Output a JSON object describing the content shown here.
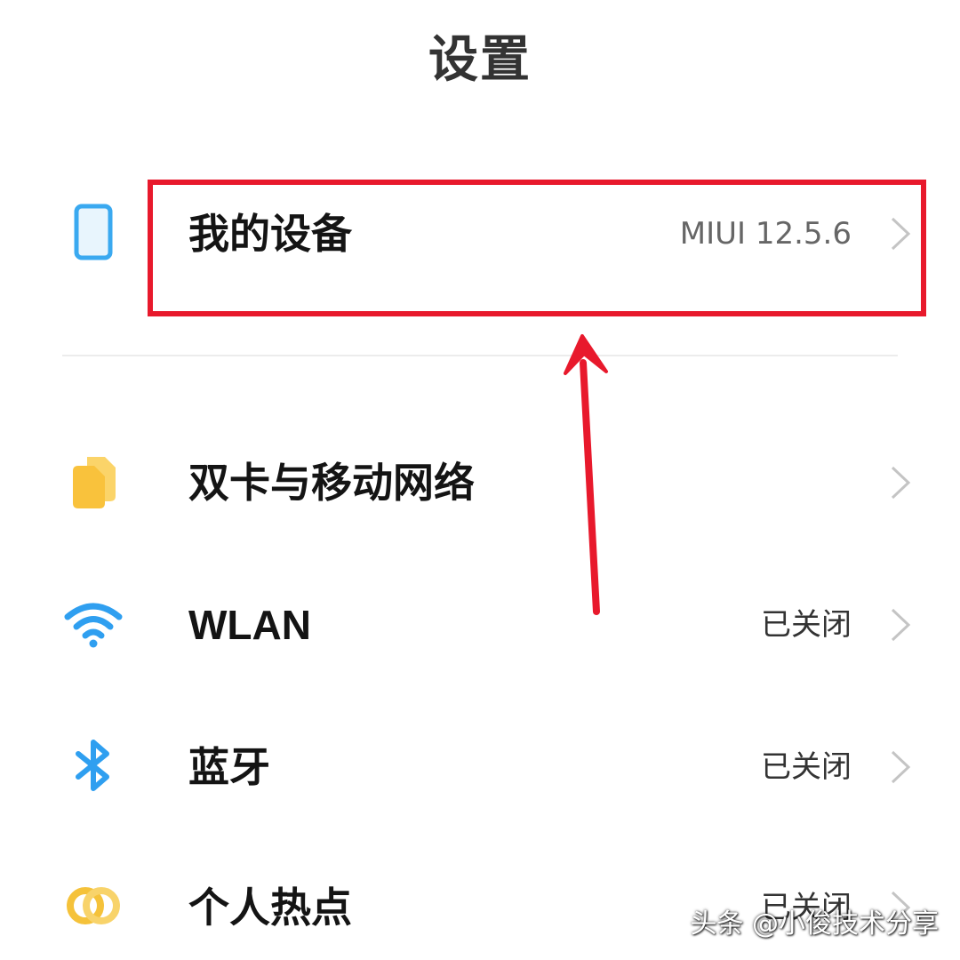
{
  "header": {
    "title": "设置"
  },
  "settings": {
    "my_device": {
      "label": "我的设备",
      "value": "MIUI 12.5.6"
    },
    "sim_network": {
      "label": "双卡与移动网络"
    },
    "wlan": {
      "label": "WLAN",
      "value": "已关闭"
    },
    "bluetooth": {
      "label": "蓝牙",
      "value": "已关闭"
    },
    "hotspot": {
      "label": "个人热点",
      "value": "已关闭"
    }
  },
  "icons": {
    "my_device": "phone-icon",
    "sim_network": "sim-card-icon",
    "wlan": "wifi-icon",
    "bluetooth": "bluetooth-icon",
    "hotspot": "hotspot-icon",
    "chevron": "chevron-right-icon"
  },
  "colors": {
    "highlight": "#e8192c",
    "phone_icon": "#3aa9f0",
    "sim_icon": "#f9c23c",
    "wifi_icon": "#2f9ff0",
    "bluetooth_icon": "#2f9ff0",
    "hotspot_icon": "#f5c23a"
  },
  "watermark": {
    "text": "头条 @小俊技术分享"
  }
}
